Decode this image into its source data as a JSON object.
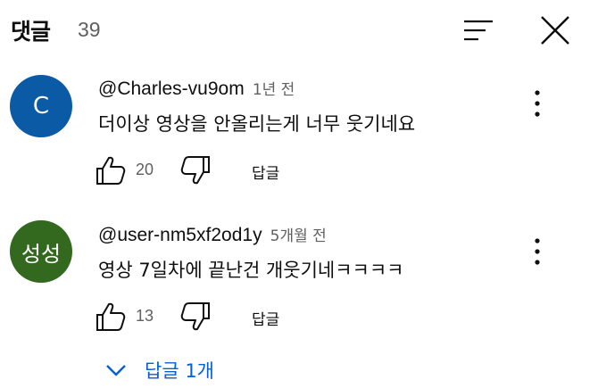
{
  "header": {
    "title": "댓글",
    "count": "39"
  },
  "comments": [
    {
      "avatar_text": "C",
      "avatar_color": "#0b5aa6",
      "author": "@Charles-vu9om",
      "time": "1년 전",
      "text": "더이상 영상을 안올리는게 너무 웃기네요",
      "likes": "20",
      "reply_label": "답글"
    },
    {
      "avatar_text": "성성",
      "avatar_color": "#33691e",
      "author": "@user-nm5xf2od1y",
      "time": "5개월 전",
      "text": "영상 7일차에 끝난건 개웃기네ㅋㅋㅋㅋ",
      "likes": "13",
      "reply_label": "답글"
    }
  ],
  "replies_toggle": {
    "label": "답글 1개",
    "color": "#065fd4"
  },
  "icons": {
    "sort": "sort-icon",
    "close": "close-icon",
    "more": "more-vert-icon",
    "like": "thumb-up-icon",
    "dislike": "thumb-down-icon",
    "expand": "chevron-down-icon"
  }
}
